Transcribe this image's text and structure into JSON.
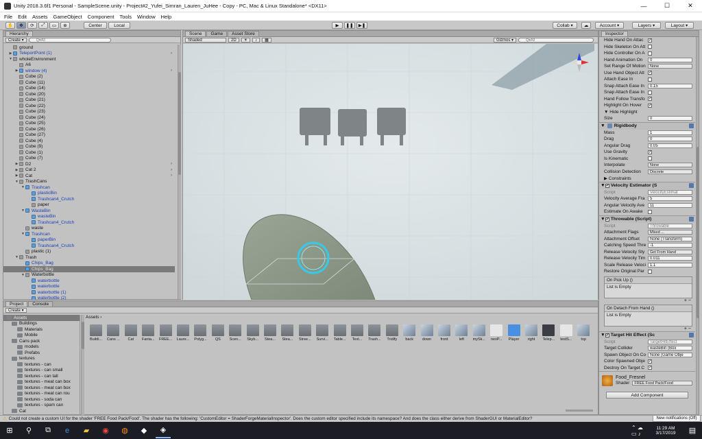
{
  "window": {
    "title": "Unity 2018.3.6f1 Personal - SampleScene.unity - Project#2_Yufei_Simran_Lauren_JuHee - Copy - PC, Mac & Linux Standalone* <DX11>",
    "minimize": "—",
    "maximize": "☐",
    "close": "✕"
  },
  "menu": [
    "File",
    "Edit",
    "Assets",
    "GameObject",
    "Component",
    "Tools",
    "Window",
    "Help"
  ],
  "toolbar": {
    "center": "Center",
    "local": "Local",
    "collab": "Collab ▾",
    "account": "Account ▾",
    "layers": "Layers ▾",
    "layout": "Layout ▾",
    "cloud": "☁"
  },
  "hierarchy": {
    "tab": "Hierarchy",
    "create": "Create ▾",
    "search": "Q▾All",
    "rows": [
      {
        "t": "ground",
        "d": 1,
        "a": "",
        "b": false
      },
      {
        "t": "TeleportPoint (1)",
        "d": 1,
        "a": "▶",
        "b": true
      },
      {
        "t": "wholeEnvironment",
        "d": 1,
        "a": "▼",
        "b": false
      },
      {
        "t": "A6",
        "d": 2,
        "a": "",
        "b": false
      },
      {
        "t": "window (4)",
        "d": 2,
        "a": "▶",
        "b": true
      },
      {
        "t": "Cube (2)",
        "d": 2,
        "a": "",
        "b": false
      },
      {
        "t": "Cube (11)",
        "d": 2,
        "a": "",
        "b": false
      },
      {
        "t": "Cube (14)",
        "d": 2,
        "a": "",
        "b": false
      },
      {
        "t": "Cube (20)",
        "d": 2,
        "a": "",
        "b": false
      },
      {
        "t": "Cube (21)",
        "d": 2,
        "a": "",
        "b": false
      },
      {
        "t": "Cube (22)",
        "d": 2,
        "a": "",
        "b": false
      },
      {
        "t": "Cube (23)",
        "d": 2,
        "a": "",
        "b": false
      },
      {
        "t": "Cube (24)",
        "d": 2,
        "a": "",
        "b": false
      },
      {
        "t": "Cube (25)",
        "d": 2,
        "a": "",
        "b": false
      },
      {
        "t": "Cube (26)",
        "d": 2,
        "a": "",
        "b": false
      },
      {
        "t": "Cube (27)",
        "d": 2,
        "a": "",
        "b": false
      },
      {
        "t": "Cube (4)",
        "d": 2,
        "a": "",
        "b": false
      },
      {
        "t": "Cube (9)",
        "d": 2,
        "a": "",
        "b": false
      },
      {
        "t": "Cube (1)",
        "d": 2,
        "a": "",
        "b": false
      },
      {
        "t": "Cube (7)",
        "d": 2,
        "a": "",
        "b": false
      },
      {
        "t": "D2",
        "d": 2,
        "a": "▶",
        "b": false
      },
      {
        "t": "Cat 2",
        "d": 2,
        "a": "▶",
        "b": false
      },
      {
        "t": "Cat",
        "d": 2,
        "a": "▶",
        "b": false
      },
      {
        "t": "TrashCans",
        "d": 2,
        "a": "▼",
        "b": false
      },
      {
        "t": "Trashcan",
        "d": 3,
        "a": "▼",
        "b": true
      },
      {
        "t": "plasticBin",
        "d": 4,
        "a": "",
        "b": true
      },
      {
        "t": "Trashcan4_Crutch",
        "d": 4,
        "a": "",
        "b": true
      },
      {
        "t": "paper",
        "d": 4,
        "a": "",
        "b": false
      },
      {
        "t": "WasteBin",
        "d": 3,
        "a": "▼",
        "b": true
      },
      {
        "t": "wasteBin",
        "d": 4,
        "a": "",
        "b": true
      },
      {
        "t": "Trashcan4_Crutch",
        "d": 4,
        "a": "",
        "b": true
      },
      {
        "t": "waste",
        "d": 3,
        "a": "",
        "b": false
      },
      {
        "t": "Trashcan",
        "d": 3,
        "a": "▼",
        "b": true
      },
      {
        "t": "paperBin",
        "d": 4,
        "a": "",
        "b": true
      },
      {
        "t": "Trashcan4_Crutch",
        "d": 4,
        "a": "",
        "b": true
      },
      {
        "t": "plastic (1)",
        "d": 3,
        "a": "",
        "b": false
      },
      {
        "t": "Trash",
        "d": 2,
        "a": "▼",
        "b": false
      },
      {
        "t": "Chips_Bag",
        "d": 3,
        "a": "",
        "b": true
      },
      {
        "t": "Chips_Bag",
        "d": 3,
        "a": "",
        "b": true,
        "sel": true
      },
      {
        "t": "Waterbottle",
        "d": 3,
        "a": "▼",
        "b": false
      },
      {
        "t": "waterbottle",
        "d": 4,
        "a": "",
        "b": true
      },
      {
        "t": "waterbottle",
        "d": 4,
        "a": "",
        "b": true
      },
      {
        "t": "waterbottle (1)",
        "d": 4,
        "a": "",
        "b": true
      },
      {
        "t": "waterbottle (2)",
        "d": 4,
        "a": "",
        "b": true
      }
    ]
  },
  "scene": {
    "tabs": [
      "Scene",
      "Game",
      "Asset Store"
    ],
    "shading": "Shaded",
    "mode2d": "2D",
    "gizmos": "Gizmos ▾",
    "search": "Q▾All"
  },
  "inspector": {
    "tab": "Inspector",
    "interactable_rows": [
      {
        "k": "Hide Hand On Attac",
        "type": "cb",
        "v": "✓"
      },
      {
        "k": "Hide Skeleton On Att",
        "type": "cb",
        "v": ""
      },
      {
        "k": "Hide Controller On A",
        "type": "cb",
        "v": ""
      },
      {
        "k": "Hand Animation On",
        "type": "v",
        "v": "0"
      },
      {
        "k": "Set Range Of Motion",
        "type": "dd",
        "v": "None"
      },
      {
        "k": "Use Hand Object Att",
        "type": "cb",
        "v": "✓"
      },
      {
        "k": "Attach Ease In",
        "type": "cb",
        "v": ""
      },
      {
        "k": "Snap Attach Ease In",
        "type": "v",
        "v": "0.15"
      },
      {
        "k": "Snap Attach Ease In",
        "type": "cb",
        "v": ""
      },
      {
        "k": "Hand Follow Transfo",
        "type": "cb",
        "v": "✓"
      },
      {
        "k": "Highlight On Hover",
        "type": "cb",
        "v": "✓"
      },
      {
        "k": "▼ Hide Highlight",
        "type": "none",
        "v": ""
      },
      {
        "k": "  Size",
        "type": "v",
        "v": "0"
      }
    ],
    "rigidbody": {
      "title": "Rigidbody",
      "rows": [
        {
          "k": "Mass",
          "type": "v",
          "v": "1"
        },
        {
          "k": "Drag",
          "type": "v",
          "v": "0"
        },
        {
          "k": "Angular Drag",
          "type": "v",
          "v": "0.05"
        },
        {
          "k": "Use Gravity",
          "type": "cb",
          "v": "✓"
        },
        {
          "k": "Is Kinematic",
          "type": "cb",
          "v": ""
        },
        {
          "k": "Interpolate",
          "type": "dd",
          "v": "None"
        },
        {
          "k": "Collision Detection",
          "type": "dd",
          "v": "Discrete"
        },
        {
          "k": "▶ Constraints",
          "type": "none",
          "v": ""
        }
      ]
    },
    "velocity": {
      "title": "Velocity Estimator (S",
      "rows": [
        {
          "k": "Script",
          "type": "v",
          "v": "VelocityEstimat",
          "dis": true
        },
        {
          "k": "Velocity Average Fra",
          "type": "v",
          "v": "5"
        },
        {
          "k": "Angular Velocity Ave",
          "type": "v",
          "v": "11"
        },
        {
          "k": "Estimate On Awake",
          "type": "cb",
          "v": ""
        }
      ]
    },
    "throwable": {
      "title": "Throwable (Script)",
      "rows": [
        {
          "k": "Script",
          "type": "v",
          "v": "Throwable",
          "dis": true
        },
        {
          "k": "Attachment Flags",
          "type": "dd",
          "v": "Mixed ..."
        },
        {
          "k": "Attachment Offset",
          "type": "v",
          "v": "None (Transform)"
        },
        {
          "k": "Catching Speed Thre",
          "type": "v",
          "v": "-1"
        },
        {
          "k": "Release Velocity Sty",
          "type": "dd",
          "v": "Get From Hand"
        },
        {
          "k": "Release Velocity Tim",
          "type": "v",
          "v": "0.011"
        },
        {
          "k": "Scale Release Veloci",
          "type": "v",
          "v": "1.1"
        },
        {
          "k": "Restore Original Par",
          "type": "cb",
          "v": ""
        }
      ],
      "event1": "On Pick Up ()",
      "event2": "On Detach From Hand ()",
      "empty": "List is Empty"
    },
    "target": {
      "title": "Target Hit Effect (Sc",
      "rows": [
        {
          "k": "Script",
          "type": "v",
          "v": "TargetHitEffect",
          "dis": true
        },
        {
          "k": "Target Collider",
          "type": "v",
          "v": "wasteBin (Box"
        },
        {
          "k": "Spawn Object On Co",
          "type": "v",
          "v": "None (Game Obje"
        },
        {
          "k": "Color Spawned Obje",
          "type": "cb",
          "v": "✓"
        },
        {
          "k": "Destroy On Target C",
          "type": "cb",
          "v": "✓"
        }
      ]
    },
    "material": {
      "name": "Food_Fresnel",
      "shader_label": "Shader",
      "shader": "FREE Food Pack/Food"
    },
    "add_component": "Add Component"
  },
  "project": {
    "tabs": [
      "Project",
      "Console"
    ],
    "create": "Create ▾",
    "breadcrumb": "Assets ›",
    "tree": [
      {
        "t": "Assets",
        "d": 0,
        "sel": true
      },
      {
        "t": "Buildings",
        "d": 1
      },
      {
        "t": "Materials",
        "d": 2
      },
      {
        "t": "Mobile",
        "d": 2
      },
      {
        "t": "Cans pack",
        "d": 1
      },
      {
        "t": "models",
        "d": 2
      },
      {
        "t": "Prefabs",
        "d": 2
      },
      {
        "t": "textures",
        "d": 1
      },
      {
        "t": "textures - can",
        "d": 2
      },
      {
        "t": "textures - can small",
        "d": 2
      },
      {
        "t": "textures - can tall",
        "d": 2
      },
      {
        "t": "textures - meat can box",
        "d": 2
      },
      {
        "t": "textures - meat can box",
        "d": 2
      },
      {
        "t": "textures - meat can rou",
        "d": 2
      },
      {
        "t": "textures - soda can",
        "d": 2
      },
      {
        "t": "textures - spam can",
        "d": 2
      },
      {
        "t": "Cat",
        "d": 1
      }
    ],
    "assets": [
      {
        "t": "Buildi...",
        "k": "folder"
      },
      {
        "t": "Cans ...",
        "k": "folder"
      },
      {
        "t": "Cat",
        "k": "folder"
      },
      {
        "t": "Fanta...",
        "k": "folder"
      },
      {
        "t": "FREE...",
        "k": "folder"
      },
      {
        "t": "Laure...",
        "k": "folder"
      },
      {
        "t": "Polyg...",
        "k": "folder"
      },
      {
        "t": "QS",
        "k": "folder"
      },
      {
        "t": "Scen...",
        "k": "folder"
      },
      {
        "t": "Skyb...",
        "k": "folder"
      },
      {
        "t": "Stea...",
        "k": "folder"
      },
      {
        "t": "Stea...",
        "k": "folder"
      },
      {
        "t": "Stree...",
        "k": "folder"
      },
      {
        "t": "Survi...",
        "k": "folder"
      },
      {
        "t": "Table...",
        "k": "folder"
      },
      {
        "t": "Text...",
        "k": "folder"
      },
      {
        "t": "Trash...",
        "k": "folder"
      },
      {
        "t": "Tridify",
        "k": "folder"
      },
      {
        "t": "back",
        "k": "tex"
      },
      {
        "t": "down",
        "k": "tex"
      },
      {
        "t": "front",
        "k": "tex"
      },
      {
        "t": "left",
        "k": "tex"
      },
      {
        "t": "mySk...",
        "k": "tex"
      },
      {
        "t": "nexP...",
        "k": "unity"
      },
      {
        "t": "Player",
        "k": "cube"
      },
      {
        "t": "right",
        "k": "tex"
      },
      {
        "t": "Telep...",
        "k": "dark"
      },
      {
        "t": "testS...",
        "k": "unity"
      },
      {
        "t": "top",
        "k": "tex"
      }
    ]
  },
  "status": "Could not create a custom UI for the shader 'FREE Food Pack/Food'. The shader has the following: 'CustomEditor = ShaderForgeMaterialInspector'. Does the custom editor specified include its namespace? And does the class either derive from ShaderGUI or MaterialEditor?",
  "tooltip": "New notifications (Off)",
  "taskbar": {
    "time": "11:29 AM",
    "date": "3/17/2019"
  },
  "colors": {
    "accent": "#4a7bd6",
    "selected_row": "#7a7a7a",
    "scene_sky": "#dfe6e8",
    "taskbar": "#1c1c24"
  }
}
